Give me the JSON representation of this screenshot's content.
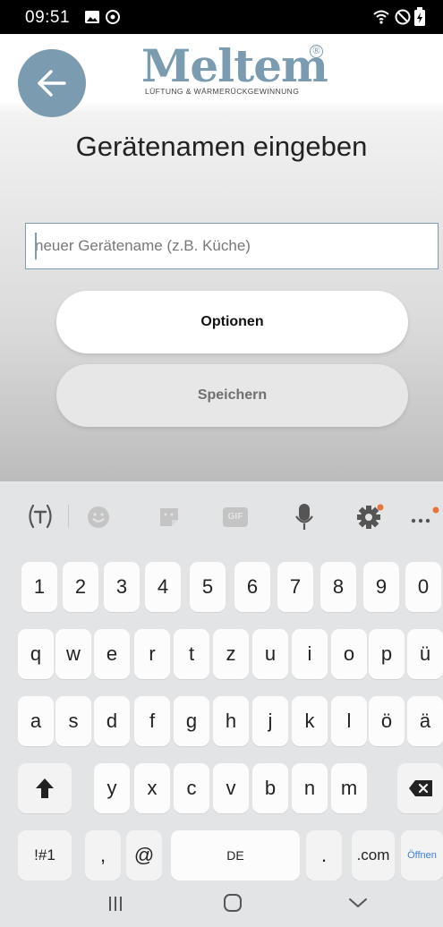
{
  "status_bar": {
    "time": "09:51"
  },
  "header": {
    "back_icon": "arrow-left-icon",
    "logo_text": "Meltem",
    "logo_mark": "®",
    "logo_tagline": "LÜFTUNG & WÄRMERÜCKGEWINNUNG"
  },
  "main": {
    "title": "Gerätenamen eingeben",
    "name_input": {
      "value": "",
      "placeholder": "neuer Gerätename (z.B. Küche)"
    },
    "options_label": "Optionen",
    "save_label": "Speichern"
  },
  "keyboard": {
    "toolbar_icons": [
      "translate-icon",
      "emoji-icon",
      "sticker-icon",
      "gif-icon",
      "microphone-icon",
      "settings-icon",
      "more-icon"
    ],
    "gif_label": "GIF",
    "rows": [
      [
        "1",
        "2",
        "3",
        "4",
        "5",
        "6",
        "7",
        "8",
        "9",
        "0"
      ],
      [
        "q",
        "w",
        "e",
        "r",
        "t",
        "z",
        "u",
        "i",
        "o",
        "p",
        "ü"
      ],
      [
        "a",
        "s",
        "d",
        "f",
        "g",
        "h",
        "j",
        "k",
        "l",
        "ö",
        "ä"
      ],
      [
        "y",
        "x",
        "c",
        "v",
        "b",
        "n",
        "m"
      ]
    ],
    "symbols_label": "!#1",
    "comma_label": ",",
    "at_label": "@",
    "space_label": "DE",
    "period_label": ".",
    "com_label": ".com",
    "action_label": "Öffnen",
    "shift_icon": "shift-arrow-icon",
    "backspace_icon": "backspace-icon"
  },
  "nav_bar": {
    "icons": [
      "recent-apps-icon",
      "home-icon",
      "back-chevron-icon"
    ]
  },
  "colors": {
    "accent": "#7a9bb0",
    "status_bar": "#000000",
    "keyboard_bg": "#e3e4e6",
    "notification_dot": "#e8743b"
  }
}
